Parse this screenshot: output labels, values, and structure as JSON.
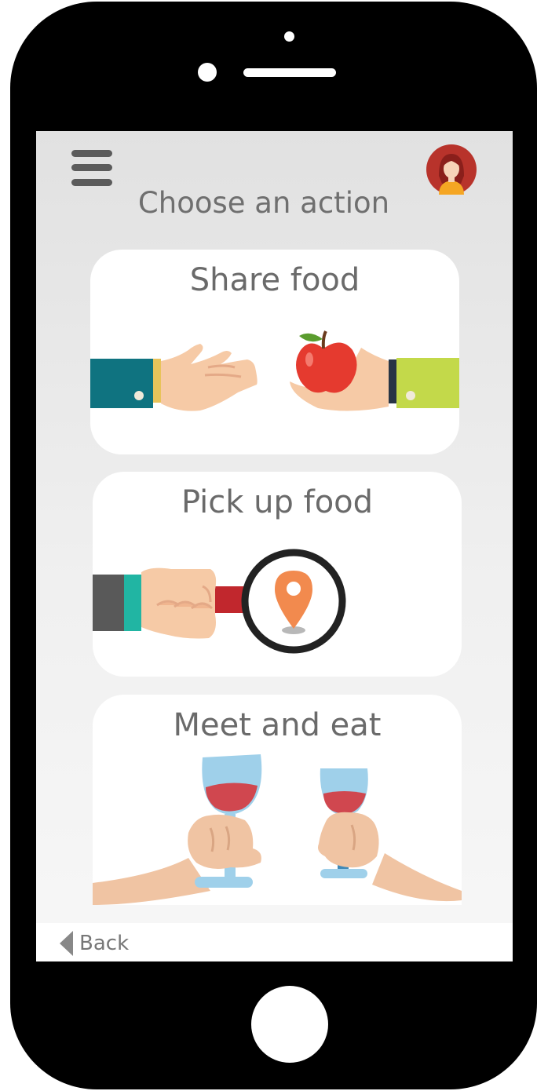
{
  "header": {
    "title": "Choose an action",
    "menu_icon": "hamburger-menu-icon",
    "avatar_icon": "user-avatar-icon"
  },
  "actions": [
    {
      "label": "Share food",
      "icon": "hands-sharing-apple-icon"
    },
    {
      "label": "Pick up food",
      "icon": "magnifier-location-pin-icon"
    },
    {
      "label": "Meet and eat",
      "icon": "wine-glasses-toast-icon"
    }
  ],
  "footer": {
    "back_label": "Back",
    "back_icon": "back-arrow-icon"
  },
  "colors": {
    "screen_bg": "#e9e9e9",
    "title_text": "#6f6f6f",
    "location_pin": "#f28a4e",
    "apple": "#e53a2f",
    "wine": "#d0474f"
  }
}
